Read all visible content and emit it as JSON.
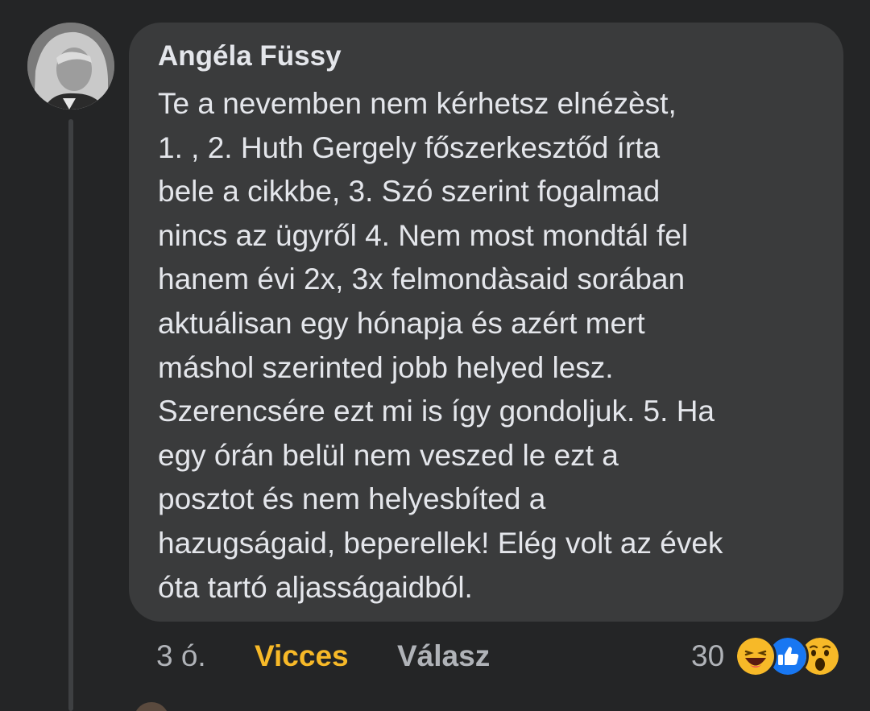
{
  "comment": {
    "author": "Angéla Füssy",
    "text": "Te a nevemben nem kérhetsz elnézèst,\n1.  , 2. Huth Gergely főszerkesztőd írta\nbele a cikkbe, 3. Szó szerint fogalmad\nnincs az ügyről 4. Nem most mondtál fel\nhanem évi 2x, 3x felmondàsaid sorában\naktuálisan egy hónapja és azért mert\nmáshol szerinted jobb helyed lesz.\nSzerencsére ezt mi is így gondoljuk. 5. Ha\negy órán belül nem veszed le ezt a\nposztot és nem helyesbíted a\nhazugságaid, beperellek! Elég volt az évek\nóta tartó aljasságaidból."
  },
  "actions": {
    "time": "3 ó.",
    "reaction_label": "Vicces",
    "reply_label": "Válasz",
    "reaction_count": "30"
  },
  "reaction_icons": [
    "haha-icon",
    "like-icon",
    "wow-icon"
  ],
  "colors": {
    "background": "#242526",
    "bubble": "#3a3b3c",
    "text": "#e4e6eb",
    "muted": "#b0b3b8",
    "haha_accent": "#f7b928",
    "like_blue": "#1877f2"
  }
}
